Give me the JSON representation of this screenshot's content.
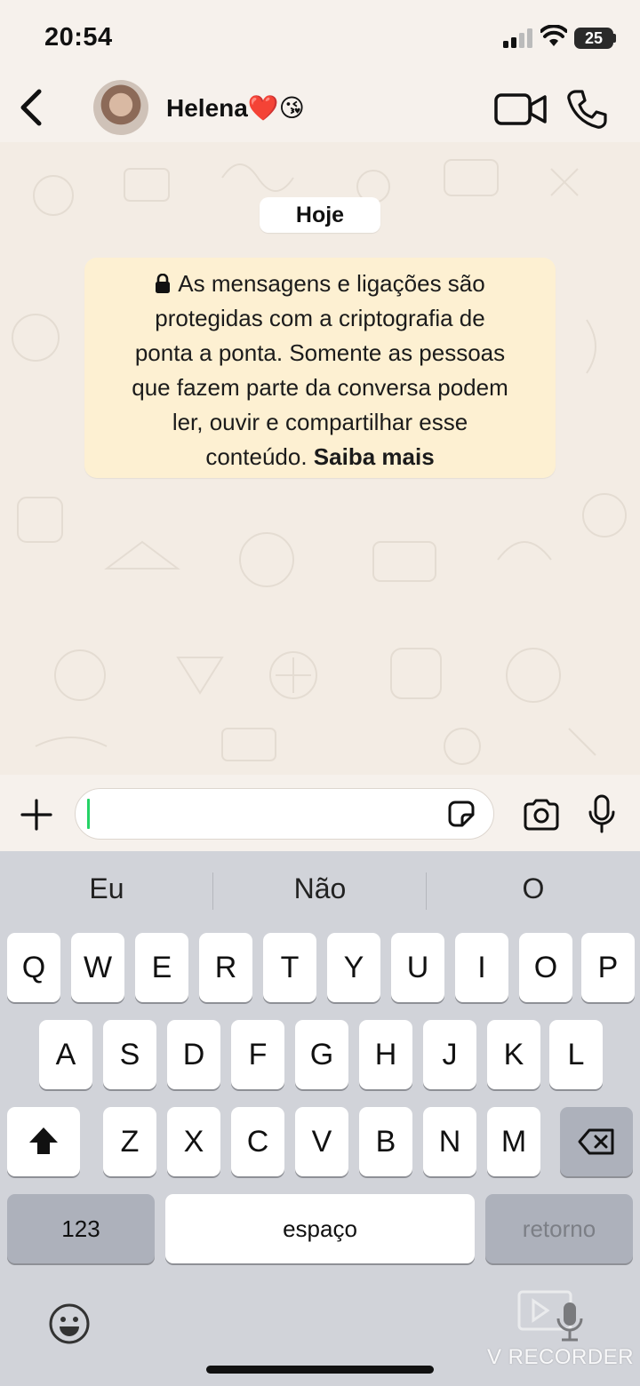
{
  "status_bar": {
    "time": "20:54",
    "battery": "25"
  },
  "header": {
    "contact_name": "Helena❤️😘"
  },
  "chat": {
    "date_chip": "Hoje",
    "e2e_notice_lines": [
      "As mensagens e ligações são",
      "protegidas com a criptografia de",
      "ponta a ponta. Somente as pessoas",
      "que fazem parte da conversa podem",
      "ler, ouvir e compartilhar esse",
      "conteúdo."
    ],
    "learn_more": "Saiba mais"
  },
  "input": {
    "value": ""
  },
  "keyboard": {
    "suggestions": [
      "Eu",
      "Não",
      "O"
    ],
    "row1": [
      "Q",
      "W",
      "E",
      "R",
      "T",
      "Y",
      "U",
      "I",
      "O",
      "P"
    ],
    "row2": [
      "A",
      "S",
      "D",
      "F",
      "G",
      "H",
      "J",
      "K",
      "L"
    ],
    "row3": [
      "Z",
      "X",
      "C",
      "V",
      "B",
      "N",
      "M"
    ],
    "numbers_key": "123",
    "space_key": "espaço",
    "return_key": "retorno"
  },
  "watermark": "V RECORDER",
  "icons": [
    "back-icon",
    "video-call-icon",
    "phone-call-icon",
    "plus-icon",
    "sticker-icon",
    "camera-icon",
    "microphone-icon",
    "lock-icon",
    "shift-icon",
    "backspace-icon",
    "emoji-icon"
  ],
  "colors": {
    "caret": "#25d366",
    "notice_bg": "#fdf0d2",
    "keyboard_bg": "#d1d3d9"
  }
}
